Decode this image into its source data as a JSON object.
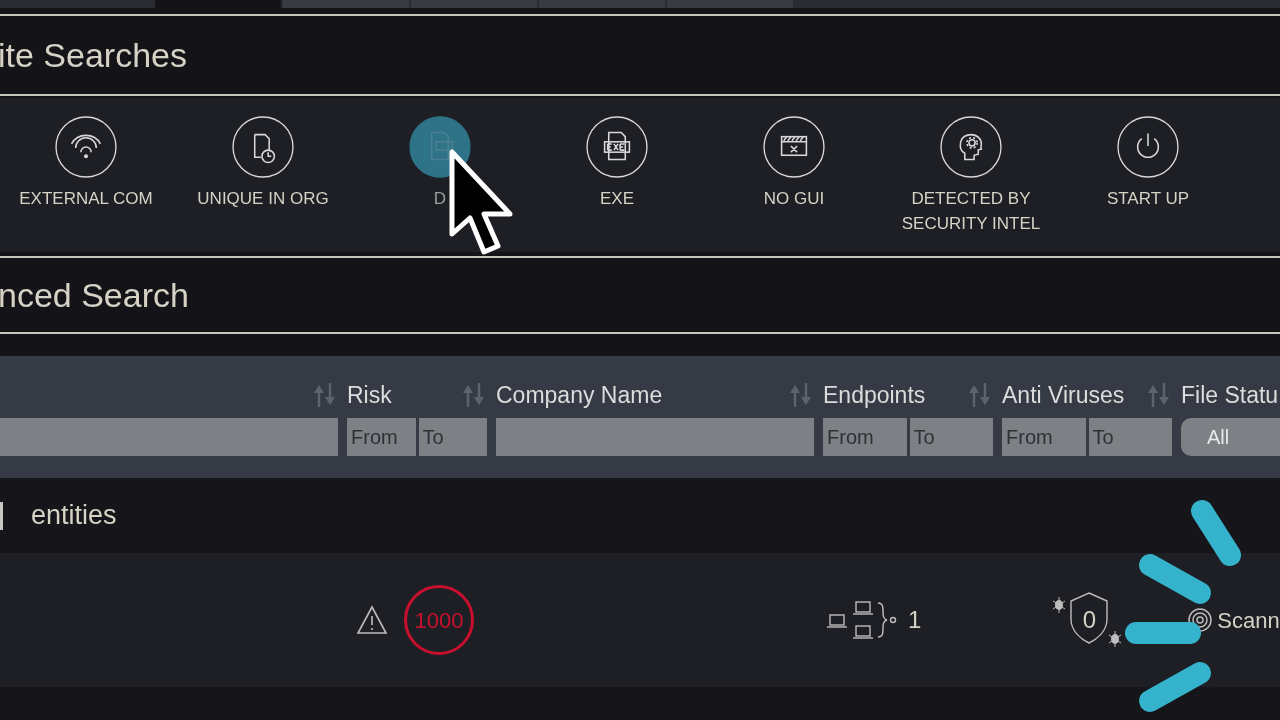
{
  "tabs": [
    {
      "selected": true
    },
    {
      "selected": false
    },
    {
      "selected": false
    },
    {
      "selected": false
    },
    {
      "selected": false
    }
  ],
  "favorite_searches": {
    "title": "ite Searches",
    "items": [
      {
        "label": "EXTERNAL COM",
        "kind": "wifi",
        "selected": false
      },
      {
        "label": "UNIQUE IN ORG",
        "kind": "file-clock",
        "selected": false
      },
      {
        "label": "D",
        "kind": "dll",
        "selected": true
      },
      {
        "label": "EXE",
        "kind": "exe",
        "selected": false
      },
      {
        "label": "NO GUI",
        "kind": "nogui",
        "selected": false
      },
      {
        "label": "DETECTED BY SECURITY INTEL",
        "kind": "head",
        "selected": false
      },
      {
        "label": "START UP",
        "kind": "power",
        "selected": false
      }
    ]
  },
  "advanced_search": {
    "title": "nced Search"
  },
  "filters": [
    {
      "kind": "text"
    },
    {
      "label": "Risk",
      "kind": "range",
      "from": "From",
      "to": "To"
    },
    {
      "label": "Company Name",
      "kind": "text"
    },
    {
      "label": "Endpoints",
      "kind": "range",
      "from": "From",
      "to": "To"
    },
    {
      "label": "Anti Viruses",
      "kind": "range",
      "from": "From",
      "to": "To"
    },
    {
      "label": "File Statu",
      "kind": "select",
      "value": "All"
    }
  ],
  "results": {
    "title": "entities",
    "rows": [
      {
        "risk": "1000",
        "endpoints": "1",
        "anti_viruses": "0",
        "file_status": "Scann"
      }
    ]
  }
}
